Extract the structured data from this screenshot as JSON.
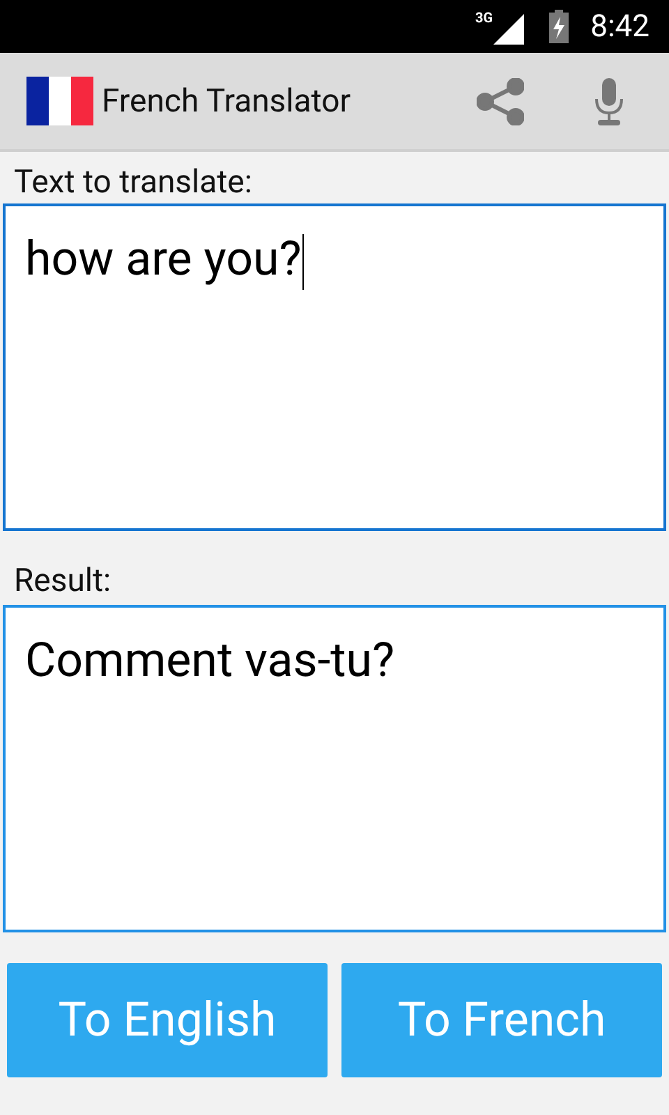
{
  "status_bar": {
    "network": "3G",
    "time": "8:42"
  },
  "app_bar": {
    "title": "French Translator"
  },
  "input": {
    "label": "Text to translate:",
    "value": "how are you?",
    "focused": true
  },
  "result": {
    "label": "Result:",
    "value": "Comment vas-tu?",
    "focused": false
  },
  "buttons": [
    {
      "label": "To English"
    },
    {
      "label": "To French"
    }
  ]
}
